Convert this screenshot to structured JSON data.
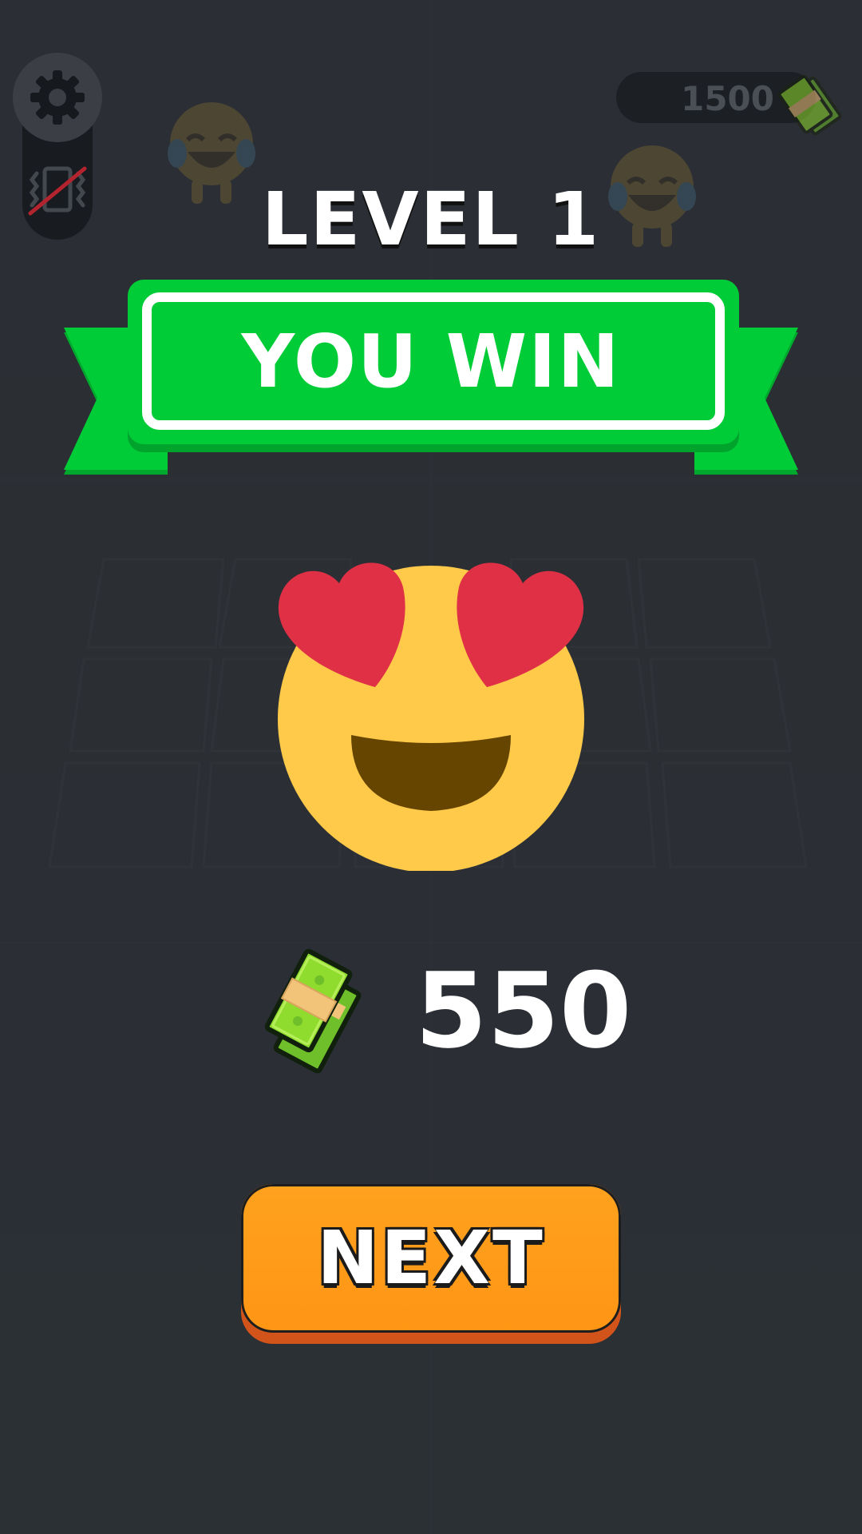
{
  "hud": {
    "currency_total": "1500",
    "settings_icon": "gear-icon",
    "vibration_icon": "vibration-off-icon"
  },
  "result": {
    "level_title": "LEVEL 1",
    "banner_text": "YOU WIN",
    "emoji": "heart-eyes-emoji",
    "reward_amount": "550",
    "reward_icon": "cash-stack-icon"
  },
  "actions": {
    "next_label": "NEXT"
  },
  "colors": {
    "background": "#2f3339",
    "banner_green": "#00cc38",
    "button_orange": "#ff9514",
    "emoji_yellow": "#ffc94a",
    "heart_red": "#e03045"
  }
}
